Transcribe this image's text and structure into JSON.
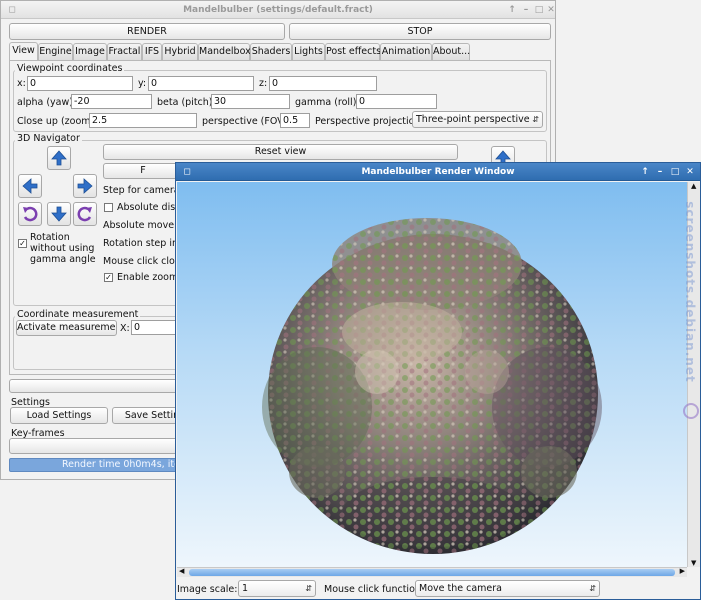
{
  "main_window": {
    "title": "Mandelbulber (settings/default.fract)",
    "render_label": "RENDER",
    "stop_label": "STOP",
    "tabs": [
      {
        "label": "View"
      },
      {
        "label": "Engine"
      },
      {
        "label": "Image"
      },
      {
        "label": "Fractal"
      },
      {
        "label": "IFS"
      },
      {
        "label": "Hybrid"
      },
      {
        "label": "Mandelbox"
      },
      {
        "label": "Shaders"
      },
      {
        "label": "Lights"
      },
      {
        "label": "Post effects"
      },
      {
        "label": "Animation"
      },
      {
        "label": "About..."
      }
    ],
    "viewpoint": {
      "title": "Viewpoint coordinates",
      "x_label": "x:",
      "x_value": "0",
      "y_label": "y:",
      "y_value": "0",
      "z_label": "z:",
      "z_value": "0",
      "alpha_label": "alpha (yaw):",
      "alpha_value": "-20",
      "beta_label": "beta (pitch):",
      "beta_value": "30",
      "gamma_label": "gamma (roll):",
      "gamma_value": "0",
      "closeup_label": "Close up (zoom):",
      "closeup_value": "2.5",
      "fov_label": "perspective (FOV):",
      "fov_value": "0.5",
      "projection_label": "Perspective projection:",
      "projection_value": "Three-point perspective"
    },
    "navigator": {
      "title": "3D Navigator",
      "reset_view": "Reset view",
      "step_label": "Step for camera m",
      "absolute_distance": "Absolute dista",
      "absolute_movement": "Absolute moveme",
      "rotation_step": "Rotation step in d",
      "mouse_click_close": "Mouse click close",
      "enable_zoom": "Enable zoom b",
      "rotation_gamma": "Rotation without using gamma angle"
    },
    "coordinate": {
      "title": "Coordinate measurement",
      "activate": "Activate measurement",
      "x_label": "X:",
      "x_value": "0"
    },
    "settings": {
      "title": "Settings",
      "load": "Load Settings",
      "save": "Save Settin"
    },
    "keyframes_title": "Key-frames",
    "status": "Render time 0h0m4s, iters/"
  },
  "render_window": {
    "title": "Mandelbulber Render Window",
    "image_scale_label": "Image scale:",
    "image_scale_value": "1",
    "mouse_function_label": "Mouse click function:",
    "mouse_function_value": "Move the camera"
  },
  "watermark": "screenshots.debian.net",
  "colors": {
    "active_title": "#3a78bc",
    "sky_top": "#8ec6f2",
    "sky_bottom": "#eaf4fb",
    "status_bar": "#7aa6dc"
  }
}
